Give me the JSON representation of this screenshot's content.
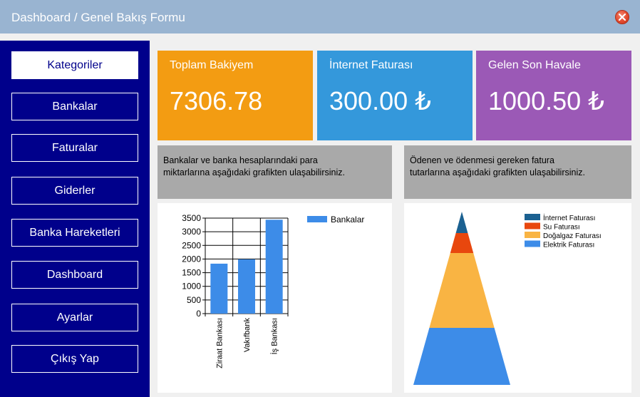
{
  "window": {
    "title": "Dashboard / Genel Bakış Formu",
    "close_icon": "close-icon"
  },
  "sidebar": {
    "items": [
      {
        "label": "Kategoriler",
        "active": true
      },
      {
        "label": "Bankalar"
      },
      {
        "label": "Faturalar"
      },
      {
        "label": "Giderler"
      },
      {
        "label": "Banka Hareketleri"
      },
      {
        "label": "Dashboard"
      },
      {
        "label": "Ayarlar"
      },
      {
        "label": "Çıkış Yap"
      }
    ]
  },
  "tiles": [
    {
      "title": "Toplam Bakiyem",
      "value": "7306.78",
      "color": "#f39c12"
    },
    {
      "title": "İnternet Faturası",
      "value": "300.00 ₺",
      "color": "#3498db"
    },
    {
      "title": "Gelen Son Havale",
      "value": "1000.50 ₺",
      "color": "#9b59b6"
    }
  ],
  "info": {
    "left": {
      "line1": "Bankalar ve banka hesaplarındaki para",
      "line2": "miktarlarına aşağıdaki grafikten ulaşabilirsiniz."
    },
    "right": {
      "line1": "Ödenen ve ödenmesi gereken fatura",
      "line2": "tutarlarına aşağıdaki grafikten ulaşabilirsiniz."
    }
  },
  "chart_data": [
    {
      "type": "bar",
      "categories": [
        "Ziraat Bankası",
        "Vakıfbank",
        "İş Bankası"
      ],
      "series": [
        {
          "name": "Bankalar",
          "values": [
            1830,
            1990,
            3440
          ],
          "color": "#3d8ce8"
        }
      ],
      "ylim": [
        0,
        3500
      ],
      "yticks": [
        "3500",
        "3000",
        "2500",
        "2000",
        "1500",
        "1000",
        "500",
        "0"
      ],
      "grid": true,
      "legend": "top-right"
    },
    {
      "type": "pyramid",
      "categories": [
        "İnternet Faturası",
        "Su Faturası",
        "Doğalgaz Faturası",
        "Elektrik Faturası"
      ],
      "values": [
        300,
        280,
        1050,
        800
      ],
      "colors": [
        "#1b6191",
        "#e8470e",
        "#f9b443",
        "#3d8ce8"
      ],
      "legend": "top-right"
    }
  ]
}
